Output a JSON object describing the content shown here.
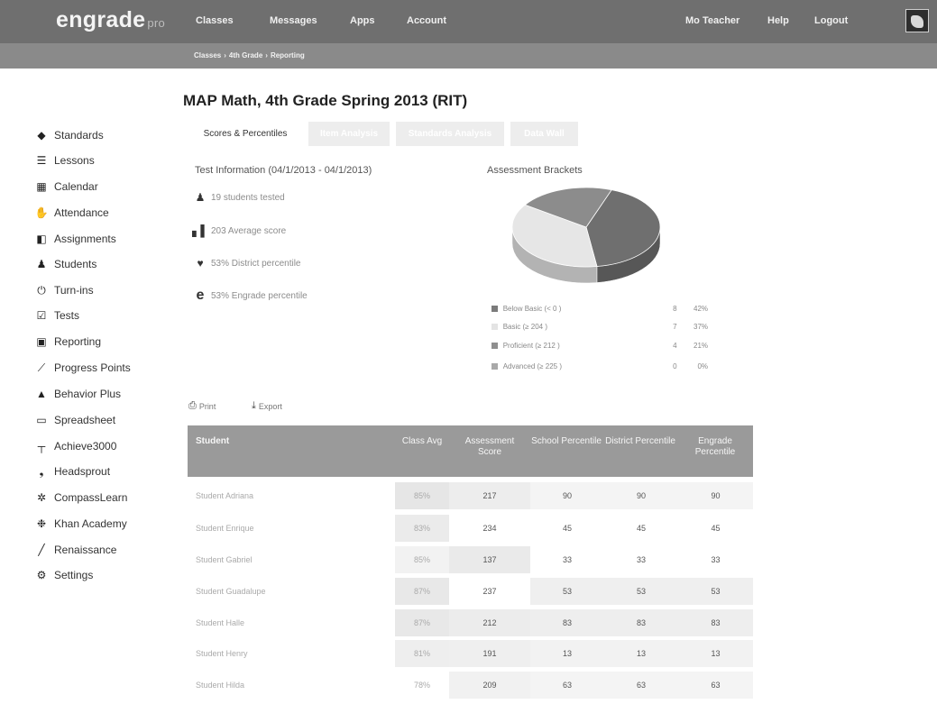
{
  "header": {
    "logo": "engrade",
    "logo_sub": "pro",
    "nav": [
      "Classes",
      "Messages",
      "Apps",
      "Account"
    ],
    "right_nav": [
      "Mo Teacher",
      "Help",
      "Logout"
    ]
  },
  "breadcrumb": [
    "Classes",
    "4th Grade",
    "Reporting"
  ],
  "page_title": "MAP Math, 4th Grade Spring 2013 (RIT)",
  "sidebar": {
    "items": [
      {
        "label": "Standards",
        "icon": "tag-icon"
      },
      {
        "label": "Lessons",
        "icon": "list-icon"
      },
      {
        "label": "Calendar",
        "icon": "calendar-icon"
      },
      {
        "label": "Attendance",
        "icon": "hand-icon"
      },
      {
        "label": "Assignments",
        "icon": "assignment-icon"
      },
      {
        "label": "Students",
        "icon": "students-icon"
      },
      {
        "label": "Turn-ins",
        "icon": "turnin-icon"
      },
      {
        "label": "Tests",
        "icon": "test-check-icon"
      },
      {
        "label": "Reporting",
        "icon": "reporting-icon"
      },
      {
        "label": "Progress Points",
        "icon": "progress-chart-icon"
      },
      {
        "label": "Behavior Plus",
        "icon": "warning-triangle-icon"
      },
      {
        "label": "Spreadsheet",
        "icon": "spreadsheet-icon"
      },
      {
        "label": "Achieve3000",
        "icon": "achieve-icon"
      },
      {
        "label": "Headsprout",
        "icon": "headsprout-icon"
      },
      {
        "label": "CompassLearn",
        "icon": "compass-icon"
      },
      {
        "label": "Khan Academy",
        "icon": "khan-icon"
      },
      {
        "label": "Renaissance",
        "icon": "renaissance-icon"
      },
      {
        "label": "Settings",
        "icon": "gear-icon"
      }
    ]
  },
  "tabs": [
    {
      "label": "Scores & Percentiles",
      "active": true
    },
    {
      "label": "Item Analysis",
      "active": false
    },
    {
      "label": "Standards Analysis",
      "active": false
    },
    {
      "label": "Data Wall",
      "active": false
    }
  ],
  "test_info": {
    "heading": "Test Information (04/1/2013 - 04/1/2013)",
    "rows": [
      {
        "text": "19 students tested",
        "icon": "students-icon"
      },
      {
        "text": "203 Average score",
        "icon": "bar-chart-icon"
      },
      {
        "text": "53% District percentile",
        "icon": "map-pin-icon"
      },
      {
        "text": "53% Engrade percentile",
        "icon": "engrade-e-icon"
      }
    ]
  },
  "brackets": {
    "heading": "Assessment Brackets",
    "legend": [
      {
        "label": "Below Basic (< 0 )",
        "count": "8",
        "percent": "42%",
        "color": "#7b7b7b"
      },
      {
        "label": "Basic (≥ 204 )",
        "count": "7",
        "percent": "37%",
        "color": "#e4e4e4"
      },
      {
        "label": "Proficient (≥ 212 )",
        "count": "4",
        "percent": "21%",
        "color": "#8f8f8f"
      },
      {
        "label": "Advanced (≥ 225 )",
        "count": "0",
        "percent": "0%",
        "color": "#a9a9a9"
      }
    ]
  },
  "chart_data": {
    "type": "pie",
    "title": "Assessment Brackets",
    "categories": [
      "Below Basic (< 0 )",
      "Basic (≥ 204 )",
      "Proficient (≥ 212 )",
      "Advanced (≥ 225 )"
    ],
    "values": [
      8,
      7,
      4,
      0
    ],
    "percent_labels": [
      "42%",
      "37%",
      "21%",
      "0%"
    ],
    "colors": [
      "#6f6f6f",
      "#e6e6e6",
      "#8c8c8c",
      "#a9a9a9"
    ],
    "legend_position": "bottom"
  },
  "toolbar": {
    "print": "Print",
    "export": "Export"
  },
  "table": {
    "headers": [
      "Student",
      "Class Avg",
      "Assessment Score",
      "School Percentile",
      "District Percentile",
      "Engrade Percentile"
    ],
    "rows": [
      {
        "name": "Student Adriana",
        "avg": "85%",
        "score": "217",
        "school": "90",
        "district": "90",
        "engrade": "90"
      },
      {
        "name": "Student Enrique",
        "avg": "83%",
        "score": "234",
        "school": "45",
        "district": "45",
        "engrade": "45"
      },
      {
        "name": "Student Gabriel",
        "avg": "85%",
        "score": "137",
        "school": "33",
        "district": "33",
        "engrade": "33"
      },
      {
        "name": "Student Guadalupe",
        "avg": "87%",
        "score": "237",
        "school": "53",
        "district": "53",
        "engrade": "53"
      },
      {
        "name": "Student Halle",
        "avg": "87%",
        "score": "212",
        "school": "83",
        "district": "83",
        "engrade": "83"
      },
      {
        "name": "Student Henry",
        "avg": "81%",
        "score": "191",
        "school": "13",
        "district": "13",
        "engrade": "13"
      },
      {
        "name": "Student Hilda",
        "avg": "78%",
        "score": "209",
        "school": "63",
        "district": "63",
        "engrade": "63"
      }
    ]
  }
}
